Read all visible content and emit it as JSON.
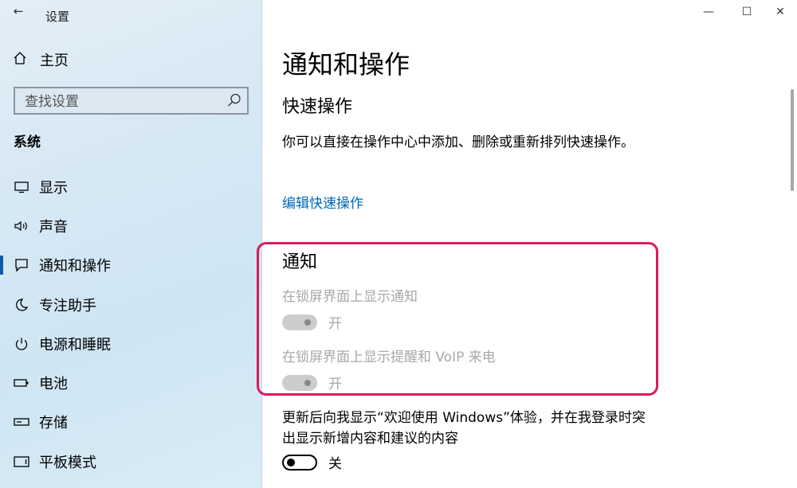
{
  "window": {
    "title": "设置",
    "minimize_glyph": "—",
    "maximize_glyph": "☐",
    "close_glyph": "✕",
    "back_glyph": "←"
  },
  "sidebar": {
    "home_label": "主页",
    "search_placeholder": "查找设置",
    "section_label": "系统",
    "items": [
      {
        "label": "显示",
        "icon": "monitor-icon"
      },
      {
        "label": "声音",
        "icon": "speaker-icon"
      },
      {
        "label": "通知和操作",
        "icon": "notification-icon",
        "active": true
      },
      {
        "label": "专注助手",
        "icon": "moon-icon"
      },
      {
        "label": "电源和睡眠",
        "icon": "power-icon"
      },
      {
        "label": "电池",
        "icon": "battery-icon"
      },
      {
        "label": "存储",
        "icon": "storage-icon"
      },
      {
        "label": "平板模式",
        "icon": "tablet-icon"
      }
    ]
  },
  "main": {
    "page_title": "通知和操作",
    "quick_actions": {
      "title": "快速操作",
      "description": "你可以直接在操作中心中添加、删除或重新排列快速操作。",
      "edit_link": "编辑快速操作"
    },
    "notifications": {
      "title": "通知",
      "lockscreen_notifications": {
        "label": "在锁屏界面上显示通知",
        "state": "开",
        "enabled": false,
        "on": true
      },
      "lockscreen_voip": {
        "label": "在锁屏界面上显示提醒和 VoIP 来电",
        "state": "开",
        "enabled": false,
        "on": true
      },
      "welcome_experience": {
        "label": "更新后向我显示“欢迎使用 Windows”体验，并在我登录时突出显示新增内容和建议的内容",
        "state": "关",
        "enabled": true,
        "on": false
      }
    }
  },
  "colors": {
    "accent": "#0a5ea8",
    "link": "#0069b8",
    "highlight_border": "#d81b5f",
    "disabled_text": "#a8a8a8"
  }
}
